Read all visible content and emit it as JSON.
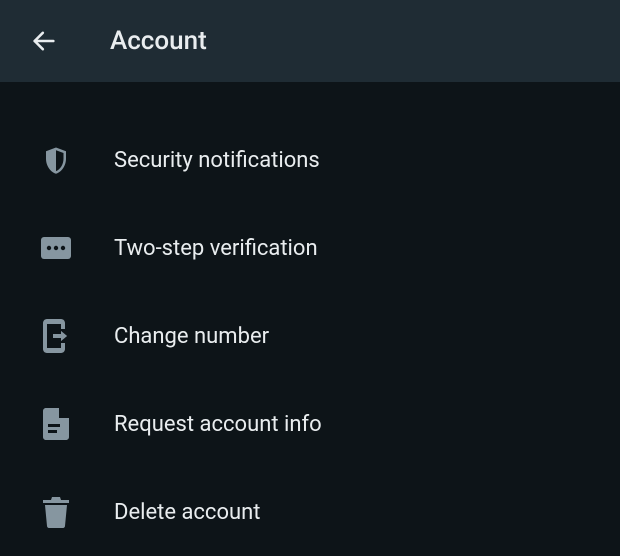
{
  "header": {
    "title": "Account"
  },
  "menu": {
    "items": [
      {
        "id": "security-notifications",
        "label": "Security notifications",
        "icon": "shield-icon"
      },
      {
        "id": "two-step-verification",
        "label": "Two-step verification",
        "icon": "dots-box-icon"
      },
      {
        "id": "change-number",
        "label": "Change number",
        "icon": "phone-arrow-icon"
      },
      {
        "id": "request-account-info",
        "label": "Request account info",
        "icon": "document-icon"
      },
      {
        "id": "delete-account",
        "label": "Delete account",
        "icon": "trash-icon"
      }
    ]
  }
}
